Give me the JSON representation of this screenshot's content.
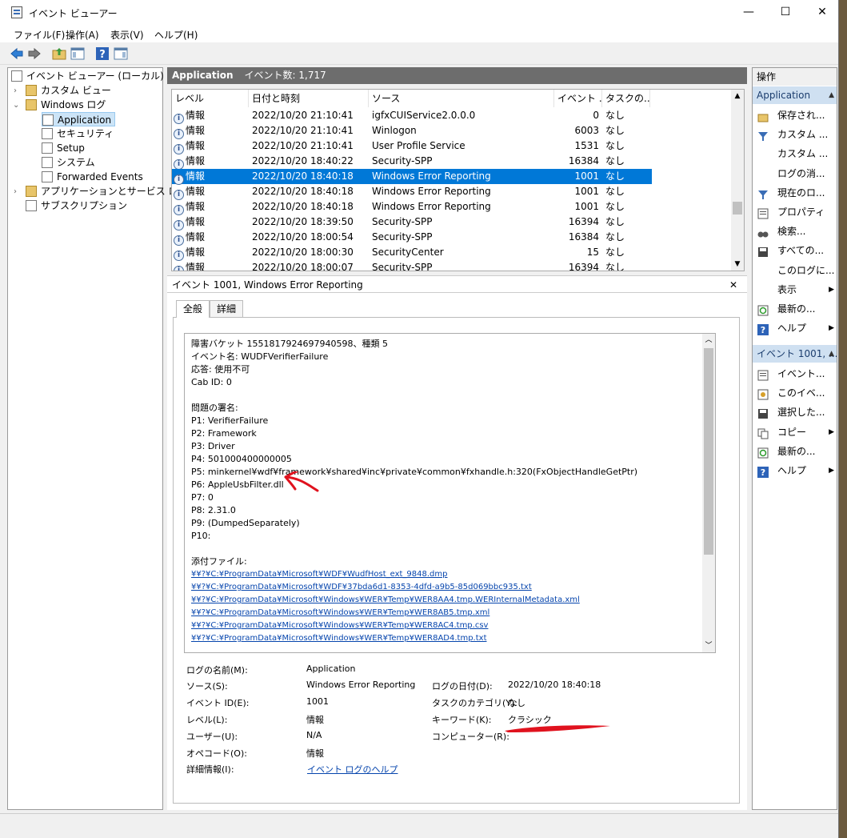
{
  "window": {
    "title": "イベント ビューアー",
    "minimize": "—",
    "maximize": "☐",
    "close": "✕"
  },
  "menubar": [
    "ファイル(F)",
    "操作(A)",
    "表示(V)",
    "ヘルプ(H)"
  ],
  "tree": {
    "root": "イベント ビューアー (ローカル)",
    "custom_views": "カスタム ビュー",
    "windows_logs": "Windows ログ",
    "application": "Application",
    "security": "セキュリティ",
    "setup": "Setup",
    "system": "システム",
    "forwarded": "Forwarded Events",
    "apps_services": "アプリケーションとサービス ログ",
    "subscriptions": "サブスクリプション"
  },
  "middle": {
    "title": "Application",
    "count": "イベント数: 1,717"
  },
  "event_list": {
    "columns": [
      "レベル",
      "日付と時刻",
      "ソース",
      "イベント ...",
      "タスクの..."
    ],
    "rows": [
      {
        "level": "情報",
        "date": "2022/10/20 21:10:41",
        "source": "igfxCUIService2.0.0.0",
        "id": "0",
        "task": "なし"
      },
      {
        "level": "情報",
        "date": "2022/10/20 21:10:41",
        "source": "Winlogon",
        "id": "6003",
        "task": "なし"
      },
      {
        "level": "情報",
        "date": "2022/10/20 21:10:41",
        "source": "User Profile Service",
        "id": "1531",
        "task": "なし"
      },
      {
        "level": "情報",
        "date": "2022/10/20 18:40:22",
        "source": "Security-SPP",
        "id": "16384",
        "task": "なし"
      },
      {
        "level": "情報",
        "date": "2022/10/20 18:40:18",
        "source": "Windows Error Reporting",
        "id": "1001",
        "task": "なし"
      },
      {
        "level": "情報",
        "date": "2022/10/20 18:40:18",
        "source": "Windows Error Reporting",
        "id": "1001",
        "task": "なし"
      },
      {
        "level": "情報",
        "date": "2022/10/20 18:40:18",
        "source": "Windows Error Reporting",
        "id": "1001",
        "task": "なし"
      },
      {
        "level": "情報",
        "date": "2022/10/20 18:39:50",
        "source": "Security-SPP",
        "id": "16394",
        "task": "なし"
      },
      {
        "level": "情報",
        "date": "2022/10/20 18:00:54",
        "source": "Security-SPP",
        "id": "16384",
        "task": "なし"
      },
      {
        "level": "情報",
        "date": "2022/10/20 18:00:30",
        "source": "SecurityCenter",
        "id": "15",
        "task": "なし"
      },
      {
        "level": "情報",
        "date": "2022/10/20 18:00:07",
        "source": "Security-SPP",
        "id": "16394",
        "task": "なし"
      }
    ]
  },
  "detail": {
    "title": "イベント 1001, Windows Error Reporting",
    "close": "✕",
    "tabs": [
      "全般",
      "詳細"
    ],
    "lines": [
      "障害バケット 1551817924697940598、種類 5",
      "イベント名: WUDFVerifierFailure",
      "応答: 使用不可",
      "Cab ID: 0",
      "",
      "問題の署名:",
      "P1: VerifierFailure",
      "P2: Framework",
      "P3: Driver",
      "P4: 501000400000005",
      "P5: minkernel¥wdf¥framework¥shared¥inc¥private¥common¥fxhandle.h:320(FxObjectHandleGetPtr)",
      "P6: AppleUsbFilter.dll",
      "P7: 0",
      "P8: 2.31.0",
      "P9: (DumpedSeparately)",
      "P10:",
      "",
      "添付ファイル:"
    ],
    "files": [
      "¥¥?¥C:¥ProgramData¥Microsoft¥WDF¥WudfHost_ext_9848.dmp",
      "¥¥?¥C:¥ProgramData¥Microsoft¥WDF¥37bda6d1-8353-4dfd-a9b5-85d069bbc935.txt",
      "¥¥?¥C:¥ProgramData¥Microsoft¥Windows¥WER¥Temp¥WER8AA4.tmp.WERInternalMetadata.xml",
      "¥¥?¥C:¥ProgramData¥Microsoft¥Windows¥WER¥Temp¥WER8AB5.tmp.xml",
      "¥¥?¥C:¥ProgramData¥Microsoft¥Windows¥WER¥Temp¥WER8AC4.tmp.csv",
      "¥¥?¥C:¥ProgramData¥Microsoft¥Windows¥WER¥Temp¥WER8AD4.tmp.txt"
    ],
    "props": {
      "log_name_label": "ログの名前(M):",
      "log_name": "Application",
      "source_label": "ソース(S):",
      "source": "Windows Error Reporting",
      "logged_label": "ログの日付(D):",
      "logged": "2022/10/20 18:40:18",
      "event_id_label": "イベント ID(E):",
      "event_id": "1001",
      "task_label": "タスクのカテゴリ(Y):",
      "task": "なし",
      "level_label": "レベル(L):",
      "level": "情報",
      "keyword_label": "キーワード(K):",
      "keyword": "クラシック",
      "user_label": "ユーザー(U):",
      "user": "N/A",
      "computer_label": "コンピューター(R):",
      "opcode_label": "オペコード(O):",
      "opcode": "情報",
      "more_label": "詳細情報(I):",
      "more_link": "イベント ログのヘルプ"
    }
  },
  "actions": {
    "header": "操作",
    "section1": "Application",
    "items1": [
      "保存され...",
      "カスタム ...",
      "カスタム ...",
      "ログの消...",
      "現在のロ...",
      "プロパティ",
      "検索...",
      "すべての...",
      "このログに...",
      "表示",
      "最新の...",
      "ヘルプ"
    ],
    "section2": "イベント 1001, ...",
    "items2": [
      "イベント...",
      "このイベ...",
      "選択した...",
      "コピー",
      "最新の...",
      "ヘルプ"
    ]
  },
  "colors": {
    "selection": "#0078d7",
    "tree_selection": "#cce4f7",
    "link": "#0645ad",
    "annotation": "#e0121e"
  }
}
